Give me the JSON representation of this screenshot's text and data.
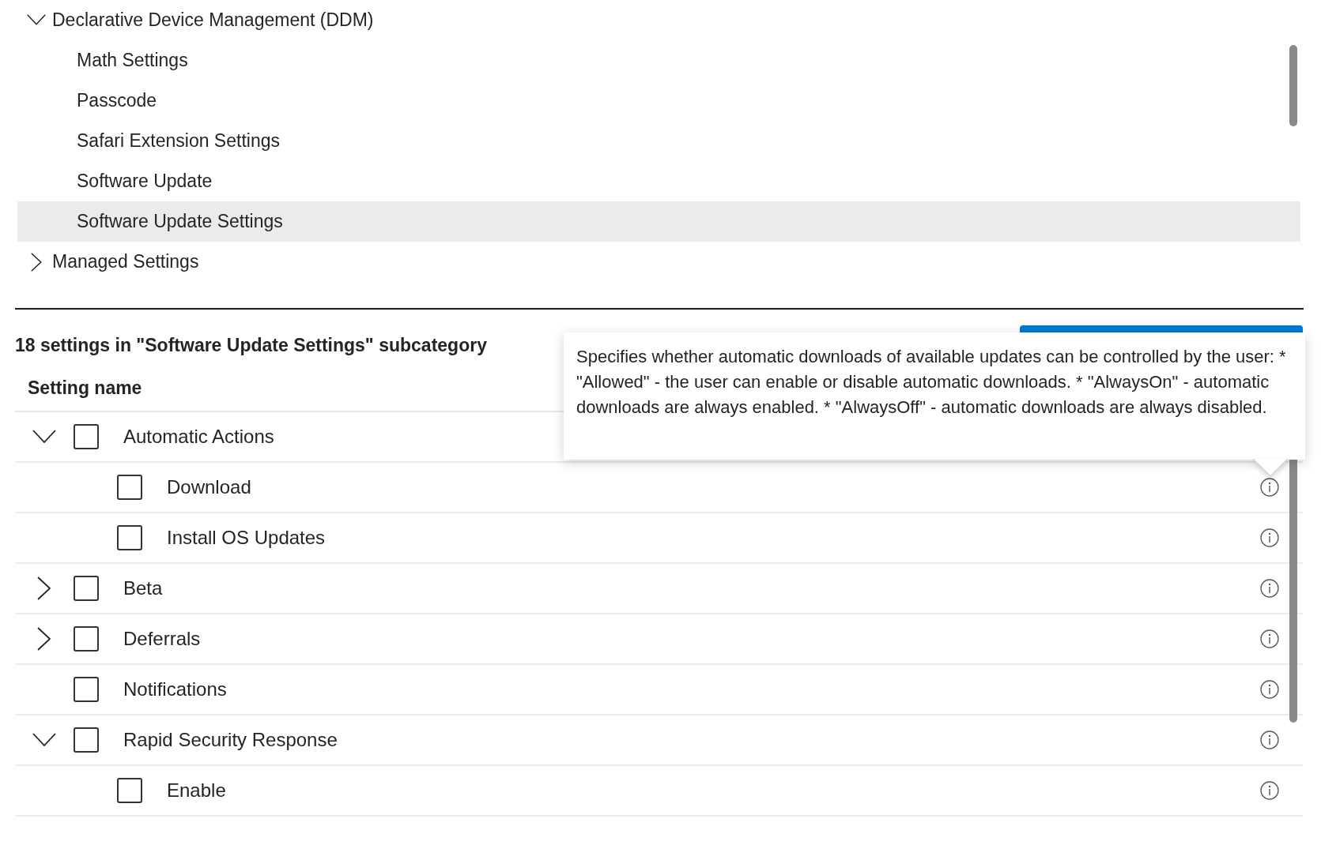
{
  "category_tree": {
    "items": [
      {
        "label": "Declarative Device Management (DDM)",
        "expanded": true,
        "selected": false,
        "children": [
          {
            "label": "Math Settings",
            "selected": false
          },
          {
            "label": "Passcode",
            "selected": false
          },
          {
            "label": "Safari Extension Settings",
            "selected": false
          },
          {
            "label": "Software Update",
            "selected": false
          },
          {
            "label": "Software Update Settings",
            "selected": true
          }
        ]
      },
      {
        "label": "Managed Settings",
        "expanded": false,
        "selected": false
      }
    ]
  },
  "settings": {
    "heading": "18 settings in \"Software Update Settings\" subcategory",
    "column_header": "Setting name",
    "rows": [
      {
        "label": "Automatic Actions",
        "checked": false,
        "expanded": true,
        "children": [
          {
            "label": "Download",
            "checked": false
          },
          {
            "label": "Install OS Updates",
            "checked": false
          }
        ]
      },
      {
        "label": "Beta",
        "checked": false,
        "expanded": false
      },
      {
        "label": "Deferrals",
        "checked": false,
        "expanded": false
      },
      {
        "label": "Notifications",
        "checked": false
      },
      {
        "label": "Rapid Security Response",
        "checked": false,
        "expanded": true,
        "children": [
          {
            "label": "Enable",
            "checked": false
          }
        ]
      }
    ]
  },
  "tooltip": {
    "text": "Specifies whether automatic downloads of available updates can be controlled by the user: * \"Allowed\" - the user can enable or disable automatic downloads. * \"AlwaysOn\" - automatic downloads are always enabled. * \"AlwaysOff\" - automatic downloads are always disabled."
  }
}
